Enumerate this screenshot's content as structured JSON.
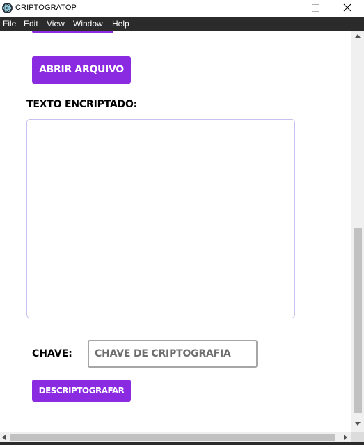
{
  "window": {
    "title": "CRIPTOGRATOP",
    "app_icon": "electron-atom-icon",
    "controls": [
      "minimize-icon",
      "maximize-icon",
      "close-icon"
    ]
  },
  "menu": {
    "items": [
      "File",
      "Edit",
      "View",
      "Window",
      "Help"
    ]
  },
  "main": {
    "open_file_button": "ABRIR ARQUIVO",
    "encrypted_text_label": "TEXTO ENCRIPTADO:",
    "encrypted_text_value": "",
    "key_label": "CHAVE:",
    "key_input": {
      "value": "",
      "placeholder": "CHAVE DE CRIPTOGRAFIA"
    },
    "decrypt_button": "DESCRIPTOGRAFAR"
  },
  "colors": {
    "accent": "#8a2be2",
    "menubar": "#2b2b2b",
    "textarea_border": "#c8c0ef"
  }
}
